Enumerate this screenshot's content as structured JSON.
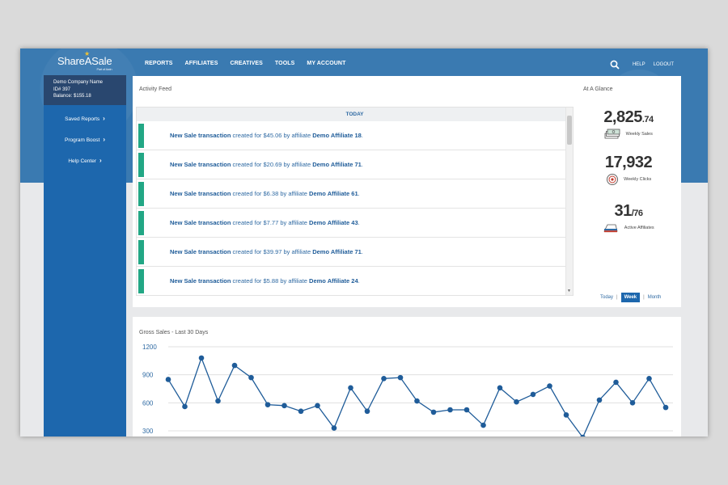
{
  "header": {
    "logo": "ShareASale",
    "logo_sub": "Part of Awin",
    "nav": [
      "REPORTS",
      "AFFILIATES",
      "CREATIVES",
      "TOOLS",
      "MY ACCOUNT"
    ],
    "help": "HELP",
    "logout": "LOGOUT"
  },
  "sidebar": {
    "account": {
      "name": "Demo Company Name",
      "id": "ID# 397",
      "balance": "Balance: $155.18"
    },
    "items": [
      {
        "label": "Saved Reports"
      },
      {
        "label": "Program Boost"
      },
      {
        "label": "Help Center"
      }
    ]
  },
  "feed": {
    "title": "Activity Feed",
    "day_header": "TODAY",
    "rows": [
      {
        "lead": "New Sale transaction",
        "middle": " created for $45.06 by affiliate ",
        "affiliate": "Demo Affiliate 18",
        "end": "."
      },
      {
        "lead": "New Sale transaction",
        "middle": " created for $20.69 by affiliate ",
        "affiliate": "Demo Affiliate 71",
        "end": "."
      },
      {
        "lead": "New Sale transaction",
        "middle": " created for $6.38 by affiliate ",
        "affiliate": "Demo Affiliate 61",
        "end": "."
      },
      {
        "lead": "New Sale transaction",
        "middle": " created for $7.77 by affiliate ",
        "affiliate": "Demo Affiliate 43",
        "end": "."
      },
      {
        "lead": "New Sale transaction",
        "middle": " created for $39.97 by affiliate ",
        "affiliate": "Demo Affiliate 71",
        "end": "."
      },
      {
        "lead": "New Sale transaction",
        "middle": " created for $5.88 by affiliate ",
        "affiliate": "Demo Affiliate 24",
        "end": "."
      }
    ]
  },
  "glance": {
    "title": "At A Glance",
    "sales": {
      "main": "2,825",
      "cents": ".74",
      "label": "Weekly Sales"
    },
    "clicks": {
      "main": "17,932",
      "label": "Weekly Clicks"
    },
    "affiliates": {
      "main": "31",
      "total": "/76",
      "label": "Active Affiliates"
    },
    "period": {
      "today": "Today",
      "week": "Week",
      "month": "Month",
      "selected": "Week"
    }
  },
  "colors": {
    "brand_blue": "#3a7ab1",
    "sidebar_blue": "#1d67ad",
    "accent_green": "#22a785",
    "line": "#1f5c99"
  },
  "chart_data": {
    "type": "line",
    "title": "Gross Sales - Last 30 Days",
    "y_ticks": [
      1200,
      900,
      600,
      300
    ],
    "ylim": [
      300,
      1200
    ],
    "grid": true,
    "series": [
      {
        "values": [
          850,
          560,
          1080,
          620,
          1000,
          870,
          580,
          570,
          510,
          570,
          330,
          760,
          510,
          860,
          870,
          620,
          500,
          525,
          525,
          360,
          760,
          610,
          690,
          780,
          470,
          230,
          630,
          820,
          600,
          860,
          550
        ]
      }
    ]
  }
}
